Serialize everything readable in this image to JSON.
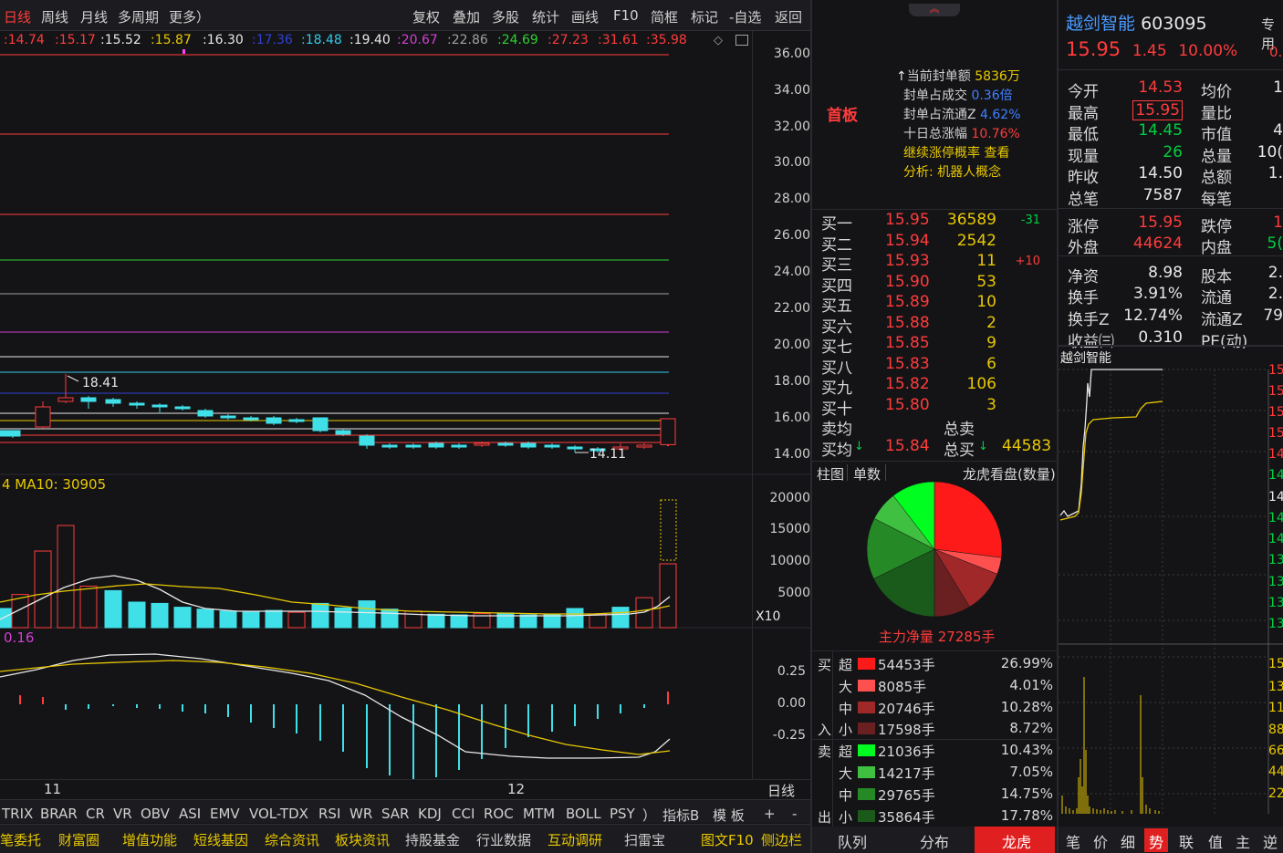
{
  "toolbar": {
    "tabs": [
      "日线",
      "周线",
      "月线",
      "多周期",
      "更多）"
    ],
    "tools": [
      "复权",
      "叠加",
      "多股",
      "统计",
      "画线",
      "F10",
      "简框",
      "标记",
      "-自选",
      "返回"
    ]
  },
  "ma_values": [
    ":14.74",
    ":15.17",
    ":15.52",
    ":15.87",
    ":16.30",
    ":17.36",
    ":18.48",
    ":19.40",
    ":20.67",
    ":22.86",
    ":24.69",
    ":27.23",
    ":31.61",
    ":35.98"
  ],
  "price_axis": [
    "36.00",
    "34.00",
    "32.00",
    "30.00",
    "28.00",
    "26.00",
    "24.00",
    "22.00",
    "20.00",
    "18.00",
    "16.00",
    "14.00"
  ],
  "price_notes": {
    "high": "18.41",
    "low": "14.11"
  },
  "volume": {
    "ma_label": "4  MA10: 30905",
    "axis": [
      "20000",
      "15000",
      "10000",
      "5000"
    ],
    "unit": "X10"
  },
  "macd": {
    "label": "0.16",
    "axis": [
      "0.25",
      "0.00",
      "-0.25"
    ]
  },
  "x_labels": {
    "a": "11",
    "b": "12",
    "period": "日线"
  },
  "indicators": [
    "TRIX",
    "BRAR",
    "CR",
    "VR",
    "OBV",
    "ASI",
    "EMV",
    "VOL-TDX",
    "RSI",
    "WR",
    "SAR",
    "KDJ",
    "CCI",
    "ROC",
    "MTM",
    "BOLL",
    "PSY",
    "）",
    "指标B",
    "模 板",
    "+",
    "-"
  ],
  "bottom_tabs": [
    "笔委托",
    "财富圈",
    "增值功能",
    "短线基因",
    "综合资讯",
    "板块资讯",
    "持股基金",
    "行业数据",
    "互动调研",
    "扫雷宝",
    "图文F10",
    "侧边栏"
  ],
  "limit_info": {
    "tag": "首板",
    "lines": [
      {
        "k": "当前封单额",
        "v": "5836万"
      },
      {
        "k": "封单占成交",
        "v": "0.36倍"
      },
      {
        "k": "封单占流通Z",
        "v": "4.62%"
      },
      {
        "k": "十日总涨幅",
        "v": "10.76%"
      },
      {
        "k": "继续涨停概率",
        "v": "查看"
      },
      {
        "k": "分析:",
        "v": "机器人概念"
      }
    ]
  },
  "order_book": [
    {
      "n": "买一",
      "p": "15.95",
      "v": "36589",
      "c": "-31"
    },
    {
      "n": "买二",
      "p": "15.94",
      "v": "2542",
      "c": ""
    },
    {
      "n": "买三",
      "p": "15.93",
      "v": "11",
      "c": "+10"
    },
    {
      "n": "买四",
      "p": "15.90",
      "v": "53",
      "c": ""
    },
    {
      "n": "买五",
      "p": "15.89",
      "v": "10",
      "c": ""
    },
    {
      "n": "买六",
      "p": "15.88",
      "v": "2",
      "c": ""
    },
    {
      "n": "买七",
      "p": "15.85",
      "v": "9",
      "c": ""
    },
    {
      "n": "买八",
      "p": "15.83",
      "v": "6",
      "c": ""
    },
    {
      "n": "买九",
      "p": "15.82",
      "v": "106",
      "c": ""
    },
    {
      "n": "买十",
      "p": "15.80",
      "v": "3",
      "c": ""
    }
  ],
  "avg": {
    "sell_label": "卖均",
    "total_sell_label": "总卖",
    "buy_label": "买均",
    "buy_avg": "15.84",
    "total_buy_label": "总买",
    "total_buy": "44583"
  },
  "chart_tabs": [
    "柱图",
    "单数",
    "龙虎看盘(数量)"
  ],
  "pie": {
    "caption": "主力净量 27285手"
  },
  "fund_flow": [
    {
      "side": "买",
      "size": "超",
      "val": "54453手",
      "pct": "26.99%",
      "color": "#ff1a1a"
    },
    {
      "side": "",
      "size": "大",
      "val": "8085手",
      "pct": "4.01%",
      "color": "#ff5050"
    },
    {
      "side": "",
      "size": "中",
      "val": "20746手",
      "pct": "10.28%",
      "color": "#a02828"
    },
    {
      "side": "入",
      "size": "小",
      "val": "17598手",
      "pct": "8.72%",
      "color": "#6a2020"
    },
    {
      "side": "卖",
      "size": "超",
      "val": "21036手",
      "pct": "10.43%",
      "color": "#00ff20"
    },
    {
      "side": "",
      "size": "大",
      "val": "14217手",
      "pct": "7.05%",
      "color": "#40c040"
    },
    {
      "side": "",
      "size": "中",
      "val": "29765手",
      "pct": "14.75%",
      "color": "#258a25"
    },
    {
      "side": "出",
      "size": "小",
      "val": "35864手",
      "pct": "17.78%",
      "color": "#1a5a1a"
    }
  ],
  "mid_tabs": [
    "队列",
    "分布",
    "龙虎"
  ],
  "stock": {
    "name": "越剑智能",
    "code": "603095",
    "price": "15.95",
    "change": "1.45",
    "pct": "10.00%",
    "badge": "专用",
    "badge_sub": "0."
  },
  "quote_rows": [
    {
      "a": "今开",
      "av": "14.53",
      "b": "均价",
      "bv": "1"
    },
    {
      "a": "最高",
      "av": "15.95",
      "b": "量比",
      "bv": ""
    },
    {
      "a": "最低",
      "av": "14.45",
      "b": "市值",
      "bv": "4"
    },
    {
      "a": "现量",
      "av": "26",
      "b": "总量",
      "bv": "10("
    },
    {
      "a": "昨收",
      "av": "14.50",
      "b": "总额",
      "bv": "1."
    },
    {
      "a": "总笔",
      "av": "7587",
      "b": "每笔",
      "bv": ""
    },
    {
      "a": "涨停",
      "av": "15.95",
      "b": "跌停",
      "bv": "1"
    },
    {
      "a": "外盘",
      "av": "44624",
      "b": "内盘",
      "bv": "5("
    },
    {
      "a": "净资",
      "av": "8.98",
      "b": "股本",
      "bv": "2."
    },
    {
      "a": "换手",
      "av": "3.91%",
      "b": "流通",
      "bv": "2."
    },
    {
      "a": "换手Z",
      "av": "12.74%",
      "b": "流通Z",
      "bv": "79"
    },
    {
      "a": "收益㈢",
      "av": "0.310",
      "b": "PE(动)",
      "bv": ""
    }
  ],
  "intraday": {
    "title": "越剑智能",
    "axis": [
      "15",
      "15",
      "15",
      "15",
      "14",
      "14",
      "14",
      "14",
      "14",
      "13",
      "13",
      "13",
      "13"
    ],
    "vol_axis": [
      "15",
      "13",
      "11",
      "88",
      "66",
      "44",
      "22"
    ]
  },
  "right_tabs": [
    "笔",
    "价",
    "细",
    "势",
    "联",
    "值",
    "主",
    "逆"
  ],
  "colors": {
    "up": "#ff3b3b",
    "down": "#40e0e8",
    "ma5": "#e8e8e8",
    "ma10": "#e8c800",
    "limit": "#ff3b3b"
  }
}
